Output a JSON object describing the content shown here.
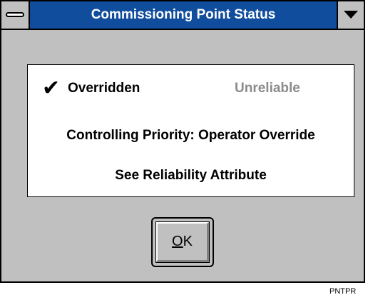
{
  "window": {
    "title": "Commissioning Point Status"
  },
  "status": {
    "check_glyph": "✔",
    "overridden_label": "Overridden",
    "unreliable_label": "Unreliable",
    "priority_text": "Controlling Priority: Operator Override",
    "reliability_text": "See Reliability Attribute"
  },
  "ok_button": {
    "mnemonic": "O",
    "rest": "K"
  },
  "footer": {
    "tag": "PNTPR"
  },
  "icons": {
    "system_menu": "system-menu-icon",
    "dropdown": "dropdown-arrow-icon",
    "check": "checkmark-icon"
  },
  "colors": {
    "title_bar": "#104d9c",
    "window_bg": "#c0c0c0",
    "disabled_text": "#8c8c8c"
  }
}
